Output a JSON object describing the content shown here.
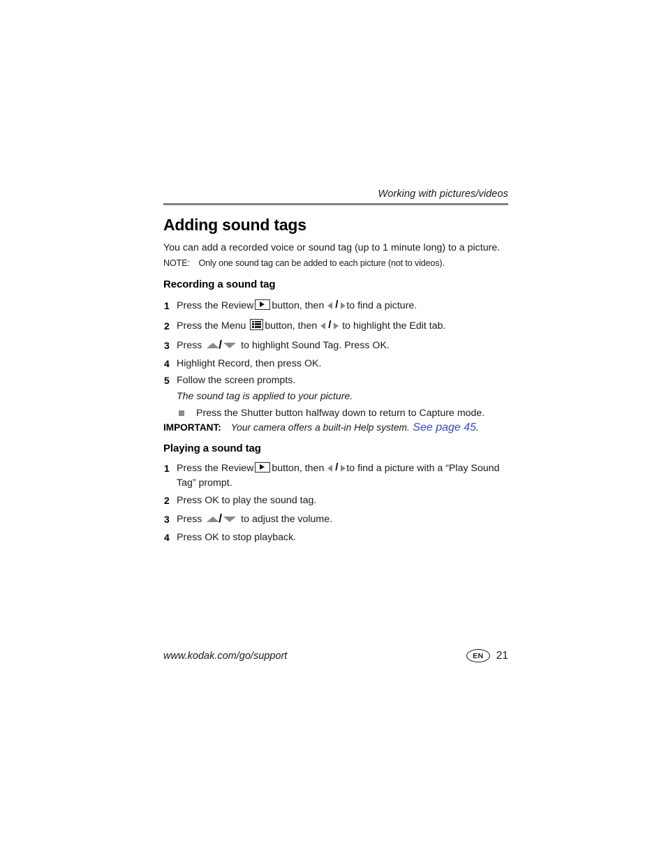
{
  "header": {
    "running_head": "Working with pictures/videos"
  },
  "title": "Adding sound tags",
  "intro": {
    "paragraph": "You can add a recorded voice or sound tag (up to 1 minute long) to a picture.",
    "note_label": "NOTE:",
    "note_text": "Only one sound tag can be added to each picture (not to videos)."
  },
  "section_recording": {
    "heading": "Recording a sound tag",
    "steps": [
      {
        "num": "1",
        "text_before_icon1": "Press the Review",
        "icon1": "review-button-icon",
        "text_mid": "button, then",
        "icon2": "left-right-arrows-icon",
        "text_after": "to find a picture."
      },
      {
        "num": "2",
        "text_before_icon1": "Press the Menu",
        "icon1": "menu-button-icon",
        "text_mid": "button, then",
        "icon2": "left-right-arrows-icon",
        "text_after": "to highlight the Edit tab."
      },
      {
        "num": "3",
        "text_before_icon1": "Press",
        "icon1": "up-down-arrows-icon",
        "text_after": "to highlight Sound Tag. Press OK."
      },
      {
        "num": "4",
        "text_plain": "Highlight Record, then press OK."
      },
      {
        "num": "5",
        "text_plain": "Follow the screen prompts."
      }
    ],
    "result_note": "The sound tag is applied to your picture.",
    "bullet": "Press the Shutter button halfway down to return to Capture mode.",
    "important_label": "IMPORTANT:",
    "important_text": "Your camera offers a built-in Help system.",
    "important_link": "See page 45",
    "important_period": "."
  },
  "section_playing": {
    "heading": "Playing a sound tag",
    "steps": [
      {
        "num": "1",
        "text_before_icon1": "Press the Review",
        "icon1": "review-button-icon",
        "text_mid": "button, then",
        "icon2": "left-right-arrows-icon",
        "text_after": "to find a picture with a “Play Sound Tag” prompt."
      },
      {
        "num": "2",
        "text_plain": "Press OK to play the sound tag."
      },
      {
        "num": "3",
        "text_before_icon1": "Press",
        "icon1": "up-down-arrows-icon",
        "text_after": "to adjust the volume."
      },
      {
        "num": "4",
        "text_plain": "Press OK to stop playback."
      }
    ]
  },
  "footer": {
    "url": "www.kodak.com/go/support",
    "language": "EN",
    "page_number": "21"
  },
  "colors": {
    "rule": "#808080",
    "link": "#3b46c4",
    "arrow_gray": "#8a8a8a",
    "text": "#1a1a1a"
  }
}
